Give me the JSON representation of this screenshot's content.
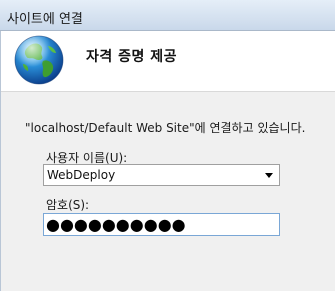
{
  "window": {
    "title": "사이트에 연결"
  },
  "header": {
    "icon": "globe-icon",
    "title": "자격 증명 제공"
  },
  "form": {
    "message": "\"localhost/Default Web Site\"에 연결하고 있습니다.",
    "username_label": "사용자 이름(U):",
    "username_value": "WebDeploy",
    "password_label": "암호(S):",
    "password_value": "●●●●●●●●●●"
  }
}
